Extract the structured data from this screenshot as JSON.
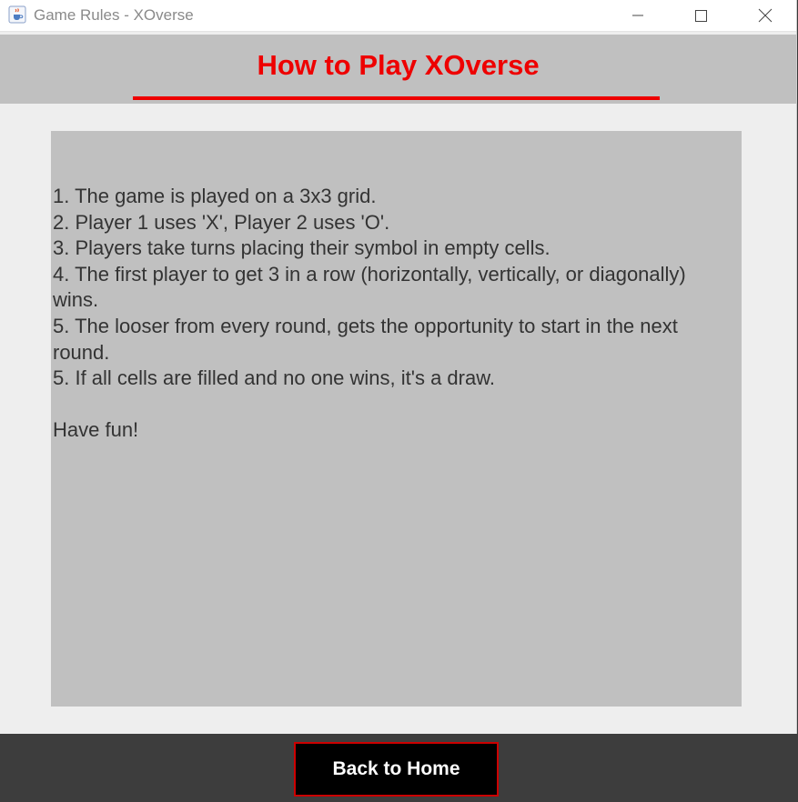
{
  "window": {
    "title": "Game Rules - XOverse",
    "icon": "java-cup-icon",
    "controls": [
      "minimize-icon",
      "maximize-icon",
      "close-icon"
    ]
  },
  "header": {
    "title": "How to Play XOverse",
    "accent_color": "#ee0000"
  },
  "rules": {
    "lines": [
      "1. The game is played on a 3x3 grid.",
      "2. Player 1 uses 'X', Player 2 uses 'O'.",
      "3. Players take turns placing their symbol in empty cells.",
      "4. The first player to get 3 in a row (horizontally, vertically, or diagonally) wins.",
      "5. The looser from every round, gets the opportunity to start in the next round.",
      "5. If all cells are filled and no one wins, it's a draw."
    ],
    "closing": "Have fun!"
  },
  "footer": {
    "back_label": "Back to Home"
  }
}
